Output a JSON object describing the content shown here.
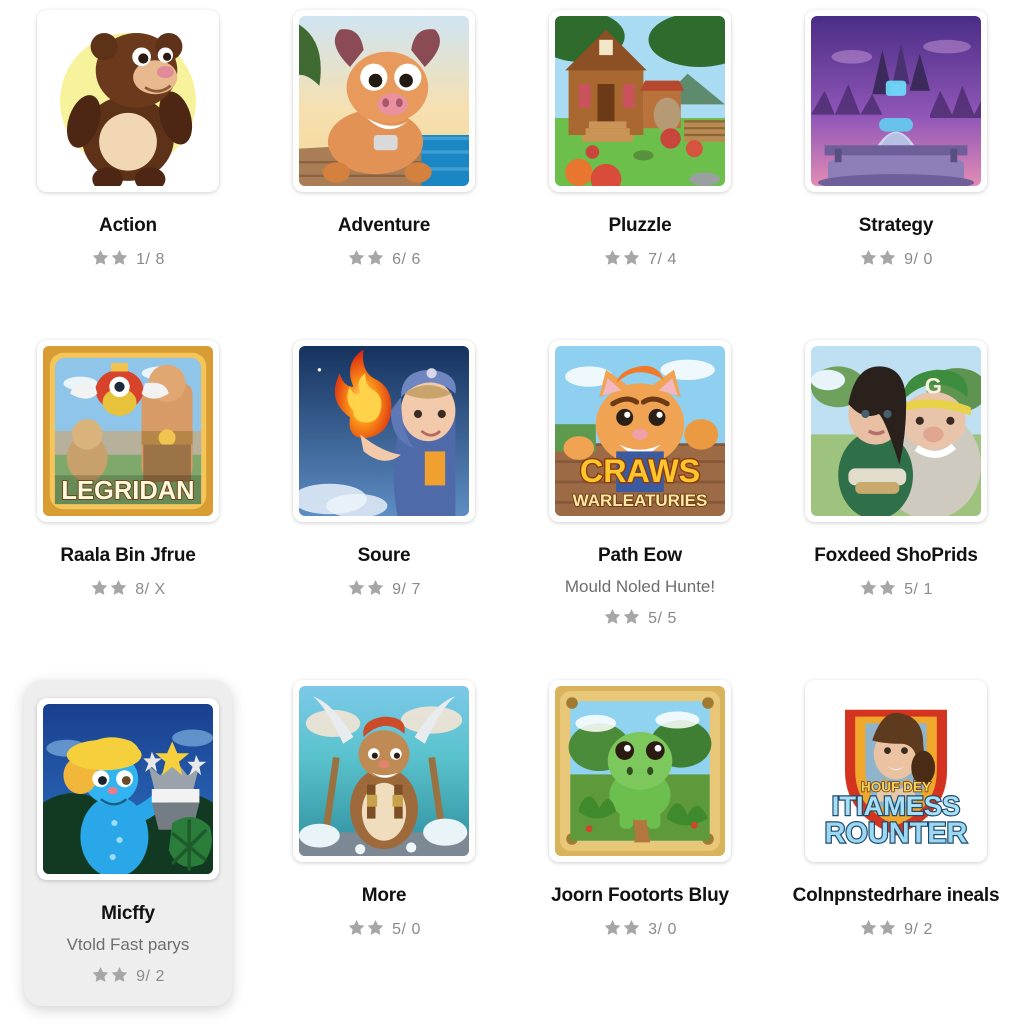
{
  "screen": {
    "title": "Game Category Grid",
    "background_color": "#ffffff",
    "columns": 4,
    "rows": 3
  },
  "style": {
    "title_color": "#111111",
    "subtitle_color": "#6d6d6d",
    "rating_color": "#8a8a8a",
    "star_color": "#a6a6a6",
    "selected_card_bg": "#eeeeee"
  },
  "cards": [
    {
      "title": "Action",
      "subtitle": "",
      "rating": "1/ 8",
      "stars": 2,
      "selected": false,
      "icon_name": "bear-character-thumbnail",
      "art": "bear"
    },
    {
      "title": "Adventure",
      "subtitle": "",
      "rating": "6/ 6",
      "stars": 2,
      "selected": false,
      "icon_name": "buffalo-character-thumbnail",
      "art": "buffalo"
    },
    {
      "title": "Pluzzle",
      "subtitle": "",
      "rating": "7/ 4",
      "stars": 2,
      "selected": false,
      "icon_name": "farm-house-thumbnail",
      "art": "farmhouse"
    },
    {
      "title": "Strategy",
      "subtitle": "",
      "rating": "9/ 0",
      "stars": 2,
      "selected": false,
      "icon_name": "purple-castle-thumbnail",
      "art": "castle"
    },
    {
      "title": "Raala Bin Jfrue",
      "subtitle": "",
      "rating": "8/ X",
      "stars": 2,
      "selected": false,
      "icon_name": "legridan-game-icon",
      "art": "legridan",
      "art_text": "LEGRIDAN"
    },
    {
      "title": "Soure",
      "subtitle": "",
      "rating": "9/ 7",
      "stars": 2,
      "selected": false,
      "icon_name": "fire-mage-girl-thumbnail",
      "art": "firemage"
    },
    {
      "title": "Path Eow",
      "subtitle": "Mould Noled Hunte!",
      "rating": "5/ 5",
      "stars": 2,
      "selected": false,
      "icon_name": "craws-warleaturies-game-icon",
      "art": "craws",
      "art_text": "CRAWS",
      "art_subtext": "WARLEATURIES"
    },
    {
      "title": "Foxdeed ShoPrids",
      "subtitle": "",
      "rating": "5/ 1",
      "stars": 2,
      "selected": false,
      "icon_name": "two-characters-green-cap-thumbnail",
      "art": "duo",
      "art_text": "G"
    },
    {
      "title": "Micffy",
      "subtitle": "Vtold Fast parys",
      "rating": "9/ 2",
      "stars": 2,
      "selected": true,
      "icon_name": "blue-mouse-trophy-thumbnail",
      "art": "bluemouse"
    },
    {
      "title": "More",
      "subtitle": "",
      "rating": "5/ 0",
      "stars": 2,
      "selected": false,
      "icon_name": "viking-axes-thumbnail",
      "art": "viking"
    },
    {
      "title": "Joorn Footorts Bluy",
      "subtitle": "",
      "rating": "3/ 0",
      "stars": 2,
      "selected": false,
      "icon_name": "green-dino-framed-thumbnail",
      "art": "dino"
    },
    {
      "title": "Colnpnstedrhare ineals",
      "subtitle": "",
      "rating": "9/ 2",
      "stars": 2,
      "selected": false,
      "icon_name": "itiamess-rounter-shield-game-icon",
      "art": "shield",
      "art_text": "ITIAMESS",
      "art_subtext": "ROUNTER",
      "art_toptext": "HOUF DEY"
    }
  ]
}
